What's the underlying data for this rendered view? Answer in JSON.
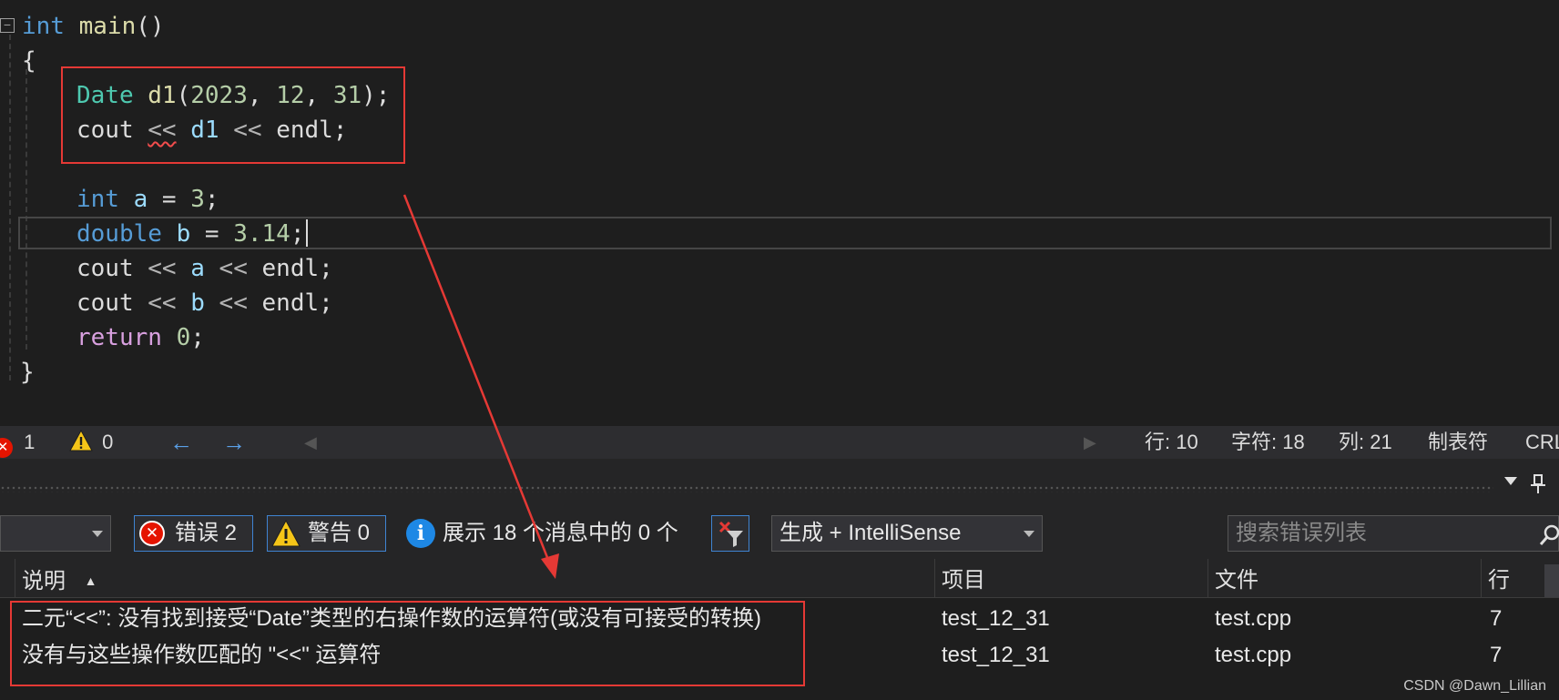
{
  "editor": {
    "lines": [
      {
        "tokens": [
          [
            "kw",
            "int"
          ],
          [
            "pl",
            " "
          ],
          [
            "fn",
            "main"
          ],
          [
            "pl",
            "()"
          ]
        ]
      },
      {
        "tokens": [
          [
            "pl",
            "{"
          ]
        ]
      },
      {
        "tokens": [
          [
            "ty",
            "Date"
          ],
          [
            "pl",
            " "
          ],
          [
            "fn",
            "d1"
          ],
          [
            "pl",
            "("
          ],
          [
            "num",
            "2023"
          ],
          [
            "pl",
            ", "
          ],
          [
            "num",
            "12"
          ],
          [
            "pl",
            ", "
          ],
          [
            "num",
            "31"
          ],
          [
            "pl",
            ");"
          ]
        ]
      },
      {
        "tokens": [
          [
            "pl",
            "cout "
          ],
          [
            "sq",
            "<<"
          ],
          [
            "pl",
            " "
          ],
          [
            "var",
            "d1"
          ],
          [
            "op",
            " << "
          ],
          [
            "pl",
            "endl;"
          ]
        ]
      },
      {
        "tokens": []
      },
      {
        "tokens": [
          [
            "kw",
            "int"
          ],
          [
            "pl",
            " "
          ],
          [
            "var",
            "a"
          ],
          [
            "pl",
            " = "
          ],
          [
            "num",
            "3"
          ],
          [
            "pl",
            ";"
          ]
        ]
      },
      {
        "tokens": [
          [
            "kw",
            "double"
          ],
          [
            "pl",
            " "
          ],
          [
            "var",
            "b"
          ],
          [
            "pl",
            " = "
          ],
          [
            "num",
            "3.14"
          ],
          [
            "pl",
            ";"
          ]
        ]
      },
      {
        "tokens": [
          [
            "pl",
            "cout "
          ],
          [
            "op",
            "<<"
          ],
          [
            "pl",
            " "
          ],
          [
            "var",
            "a"
          ],
          [
            "op",
            " << "
          ],
          [
            "pl",
            "endl;"
          ]
        ]
      },
      {
        "tokens": [
          [
            "pl",
            "cout "
          ],
          [
            "op",
            "<<"
          ],
          [
            "pl",
            " "
          ],
          [
            "var",
            "b"
          ],
          [
            "op",
            " << "
          ],
          [
            "pl",
            "endl;"
          ]
        ]
      },
      {
        "tokens": [
          [
            "ret",
            "return"
          ],
          [
            "pl",
            " "
          ],
          [
            "num",
            "0"
          ],
          [
            "pl",
            ";"
          ]
        ]
      },
      {
        "tokens": [
          [
            "pl",
            "}"
          ]
        ]
      }
    ],
    "collapse_glyph": "−"
  },
  "status": {
    "errors": "1",
    "warnings": "0",
    "line": "行: 10",
    "char": "字符: 18",
    "col": "列: 21",
    "tab": "制表符",
    "eol": "CRLF"
  },
  "toolbar": {
    "errors_label": "错误 2",
    "warnings_label": "警告 0",
    "messages_label": "展示 18 个消息中的 0 个",
    "build_select": "生成 + IntelliSense",
    "search_placeholder": "搜索错误列表"
  },
  "table": {
    "headers": {
      "desc": "说明",
      "project": "项目",
      "file": "文件",
      "line": "行"
    },
    "rows": [
      {
        "desc": "二元“<<”: 没有找到接受“Date”类型的右操作数的运算符(或没有可接受的转换)",
        "project": "test_12_31",
        "file": "test.cpp",
        "line": "7"
      },
      {
        "desc": "没有与这些操作数匹配的 \"<<\" 运算符",
        "project": "test_12_31",
        "file": "test.cpp",
        "line": "7"
      }
    ]
  },
  "watermark": "CSDN @Dawn_Lillian",
  "colors": {
    "accent": "#3f84d2",
    "error": "#e51400",
    "warning": "#f5c518",
    "annotation": "#e53935"
  }
}
